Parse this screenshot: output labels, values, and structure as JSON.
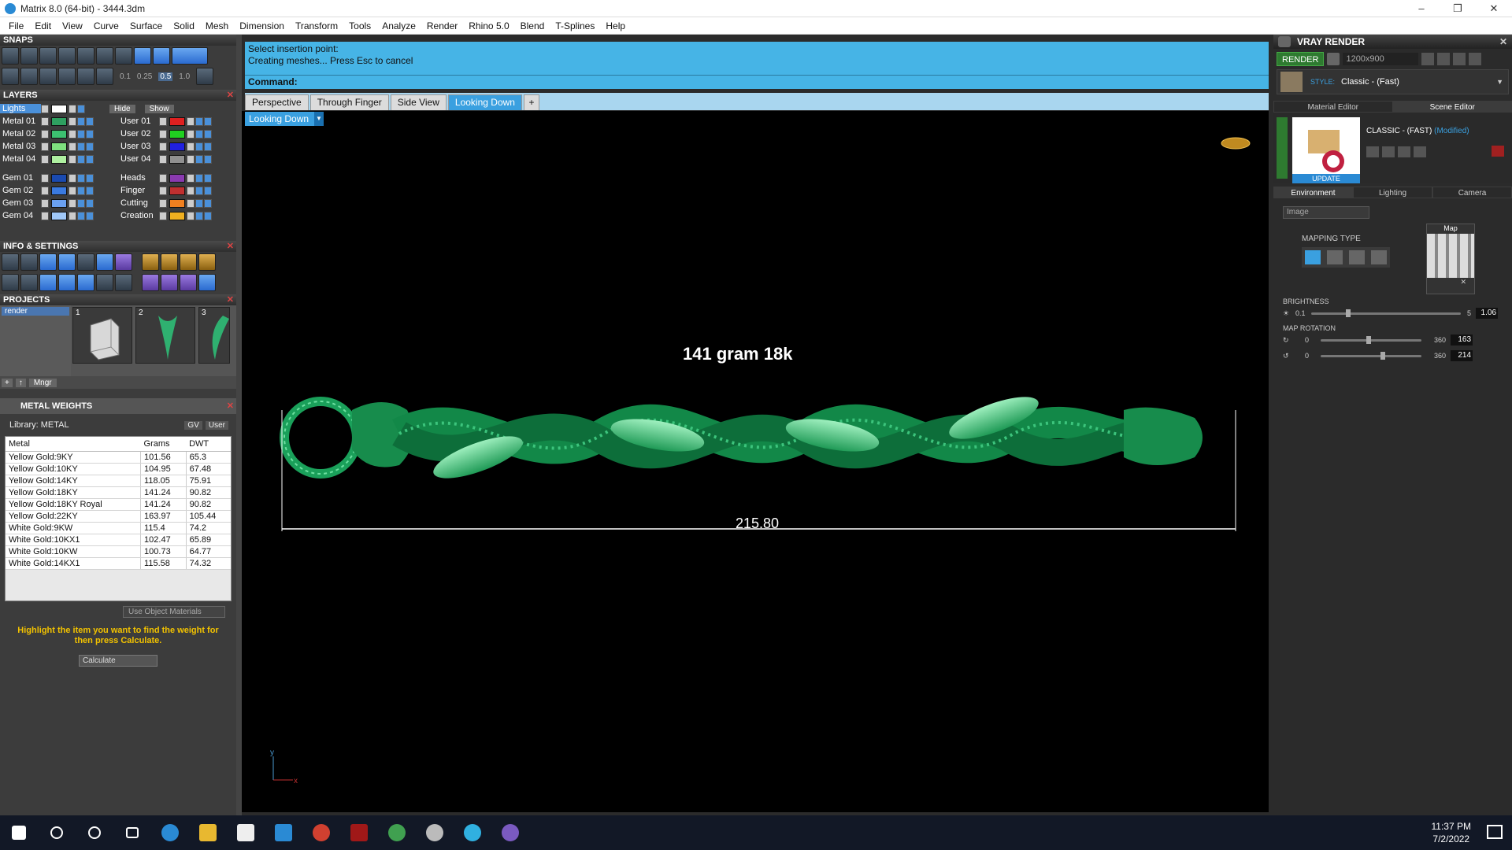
{
  "window": {
    "title": "Matrix 8.0 (64-bit) - 3444.3dm"
  },
  "menu": [
    "File",
    "Edit",
    "View",
    "Curve",
    "Surface",
    "Solid",
    "Mesh",
    "Dimension",
    "Transform",
    "Tools",
    "Analyze",
    "Render",
    "Rhino 5.0",
    "Blend",
    "T-Splines",
    "Help"
  ],
  "snaps": {
    "header": "SNAPS",
    "values": [
      "0.1",
      "0.25",
      "0.5",
      "1.0"
    ]
  },
  "layers": {
    "header": "LAYERS",
    "top_row": {
      "name": "Lights",
      "hide": "Hide",
      "show": "Show"
    },
    "left": [
      {
        "name": "Metal 01",
        "color": "#2ea060"
      },
      {
        "name": "Metal 02",
        "color": "#3cc070"
      },
      {
        "name": "Metal 03",
        "color": "#7ee07e"
      },
      {
        "name": "Metal 04",
        "color": "#aef0a0"
      },
      {
        "name": "Gem 01",
        "color": "#1a4ab0"
      },
      {
        "name": "Gem 02",
        "color": "#3a7ae0"
      },
      {
        "name": "Gem 03",
        "color": "#6aa0f0"
      },
      {
        "name": "Gem 04",
        "color": "#a0c8f8"
      }
    ],
    "right": [
      {
        "name": "User 01",
        "color": "#e02020"
      },
      {
        "name": "User 02",
        "color": "#20d020"
      },
      {
        "name": "User 03",
        "color": "#2020e0"
      },
      {
        "name": "User 04",
        "color": "#909090"
      },
      {
        "name": "Heads",
        "color": "#8a3ab0"
      },
      {
        "name": "Finger",
        "color": "#c03030"
      },
      {
        "name": "Cutting",
        "color": "#f08020"
      },
      {
        "name": "Creation",
        "color": "#f0b020"
      }
    ]
  },
  "info": {
    "header": "INFO & SETTINGS"
  },
  "projects": {
    "header": "PROJECTS",
    "selected": "render",
    "thumbs": [
      "1",
      "2",
      "3"
    ],
    "mngr": "Mngr"
  },
  "metal_weights": {
    "header": "METAL WEIGHTS",
    "library": "Library: METAL",
    "gv_label": "GV",
    "user_label": "User",
    "columns": [
      "Metal",
      "Grams",
      "DWT"
    ],
    "rows": [
      [
        "Yellow Gold:9KY",
        "101.56",
        "65.3"
      ],
      [
        "Yellow Gold:10KY",
        "104.95",
        "67.48"
      ],
      [
        "Yellow Gold:14KY",
        "118.05",
        "75.91"
      ],
      [
        "Yellow Gold:18KY",
        "141.24",
        "90.82"
      ],
      [
        "Yellow Gold:18KY Royal",
        "141.24",
        "90.82"
      ],
      [
        "Yellow Gold:22KY",
        "163.97",
        "105.44"
      ],
      [
        "White Gold:9KW",
        "115.4",
        "74.2"
      ],
      [
        "White Gold:10KX1",
        "102.47",
        "65.89"
      ],
      [
        "White Gold:10KW",
        "100.73",
        "64.77"
      ],
      [
        "White Gold:14KX1",
        "115.58",
        "74.32"
      ]
    ],
    "use_object_materials": "Use Object Materials",
    "hint": "Highlight the item you want to find the weight for then press Calculate.",
    "calculate": "Calculate"
  },
  "command": {
    "line1": "Select insertion point:",
    "line2": "Creating meshes... Press Esc to cancel",
    "prompt": "Command:"
  },
  "viewtabs": [
    "Perspective",
    "Through Finger",
    "Side View",
    "Looking Down"
  ],
  "active_view": "Looking Down",
  "viewport": {
    "annotation": "141 gram 18k",
    "dimension": "215.80",
    "axis_y": "y",
    "axis_x": "x"
  },
  "vray": {
    "header": "VRAY RENDER",
    "render": "RENDER",
    "resolution": "1200x900",
    "style_label": "STYLE:",
    "style_value": "Classic - (Fast)",
    "tabs": [
      "Material Editor",
      "Scene Editor"
    ],
    "preset_title": "CLASSIC - (FAST)",
    "preset_modified": "(Modified)",
    "update": "UPDATE",
    "env_tabs": [
      "Environment",
      "Lighting",
      "Camera"
    ],
    "env_type": "Image",
    "mapping_type": "MAPPING TYPE",
    "map_label": "Map",
    "brightness": {
      "label": "BRIGHTNESS",
      "min": "0.1",
      "max": "5",
      "value": "1.06"
    },
    "map_rotation": {
      "label": "MAP ROTATION",
      "min": "0",
      "max": "360",
      "value1": "163",
      "value2": "214"
    }
  },
  "taskbar": {
    "time": "11:37 PM",
    "date": "7/2/2022"
  }
}
